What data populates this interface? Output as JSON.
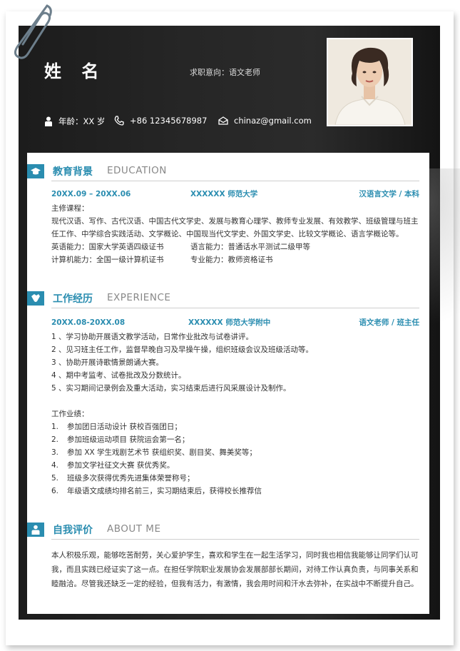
{
  "header": {
    "name": "姓 名",
    "intent": "求职意向：语文老师",
    "contact": {
      "age": "年龄：XX 岁",
      "phone": "+86 12345678987",
      "email": "chinaz@gmail.com"
    }
  },
  "education": {
    "title": "教育背景",
    "en": "EDUCATION",
    "period": "20XX.09 – 20XX.06",
    "school": "XXXXXX 师范大学",
    "major": "汉语言文学 / 本科",
    "courses_label": "主修课程：",
    "courses": "现代汉语、写作、古代汉语、中国古代文学史、发展与教育心理学、教师专业发展、有效教学、班级管理与班主任工作、中学综合实践活动、文学概论、中国现当代文学史、外国文学史、比较文学概论、语言学概论等。",
    "cert_english": "英语能力：国家大学英语四级证书",
    "cert_language": "语言能力：普通话水平测试二级甲等",
    "cert_computer": "计算机能力：全国一级计算机证书",
    "cert_profession": "专业能力：教师资格证书"
  },
  "work": {
    "title": "工作经历",
    "en": "EXPERIENCE",
    "period": "20XX.08-20XX.08",
    "school": "XXXXXX 师范大学附中",
    "role": "语文老师 / 班主任",
    "duties": [
      "1 、学习协助开展语文教学活动，日常作业批改与试卷讲评。",
      "2 、见习班主任工作，监督早晚自习及早操午操，组织班级会议及班级活动等。",
      "3 、协助开展诗歌情景朗诵大赛。",
      "4 、期中考监考、试卷批改及分数统计。",
      "5 、实习期间记录例会及重大活动，实习结束后进行风采展设计及制作。"
    ],
    "achievements_label": "工作业绩：",
    "achievements": [
      {
        "num": "1.",
        "text": "参加团日活动设计  获校百强团日；"
      },
      {
        "num": "2.",
        "text": "参加班级运动项目  获院运会第一名；"
      },
      {
        "num": "3.",
        "text": "参加 XX 学生戏剧艺术节  获组织奖、剧目奖、舞美奖等；"
      },
      {
        "num": "4.",
        "text": "参加文学社征文大赛  获优秀奖。"
      },
      {
        "num": "5.",
        "text": "班级多次获得优秀先进集体荣誉称号；"
      },
      {
        "num": "6.",
        "text": "年级语文成绩均排名前三，实习期结束后，获得校长推荐信"
      }
    ]
  },
  "self": {
    "title": "自我评价",
    "en": "ABOUT ME",
    "lines": [
      "本人积极乐观，能够吃苦耐劳，关心爱护学生，喜欢和学生在一起生活学习，同时我也相信我能够让同学们认可",
      "我，而且实践已经证实了这一点。在担任学院职业发展协会发展部部长期间，对待工作认真负责，与同事关系和",
      "睦融洽。尽管我还缺乏一定的经验，但我有活力，有激情，我会用时间和汗水去弥补，在实战中不断提升自己。"
    ]
  },
  "colors": {
    "accent": "#2a8db0",
    "dark": "#262626"
  },
  "icons": [
    "paperclip-icon",
    "person-icon",
    "phone-icon",
    "mail-icon",
    "graduation-cap-icon",
    "handshake-icon",
    "person-info-icon"
  ]
}
